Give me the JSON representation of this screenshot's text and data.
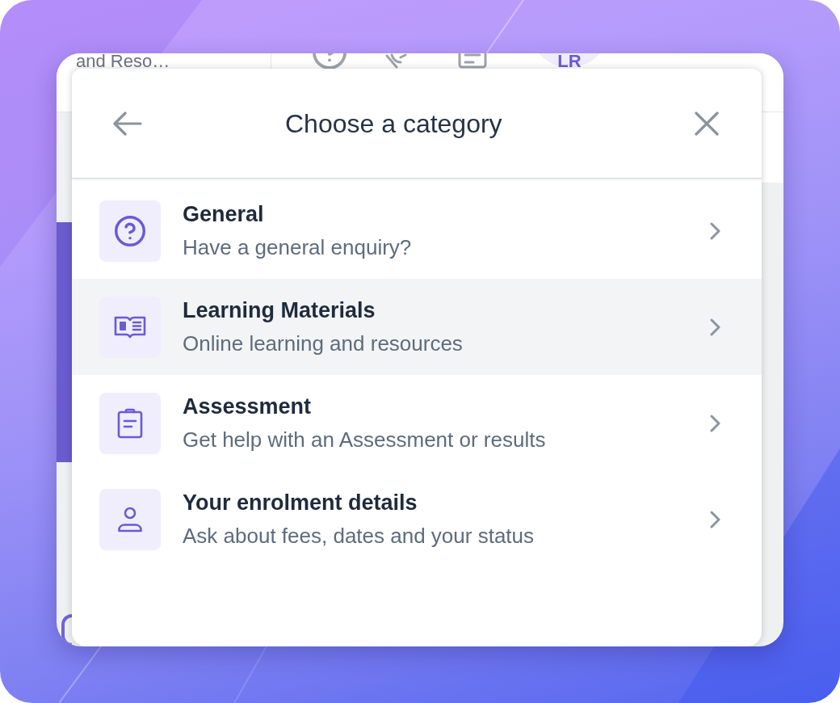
{
  "background_app": {
    "header_title": "and Reso…",
    "avatar_initials": "LR"
  },
  "dialog": {
    "title": "Choose a category",
    "categories": [
      {
        "title": "General",
        "description": "Have a general enquiry?",
        "selected": false
      },
      {
        "title": "Learning Materials",
        "description": "Online learning and resources",
        "selected": true
      },
      {
        "title": "Assessment",
        "description": "Get help with an Assessment or results",
        "selected": false
      },
      {
        "title": "Your enrolment details",
        "description": "Ask about fees, dates and your status",
        "selected": false
      }
    ]
  }
}
